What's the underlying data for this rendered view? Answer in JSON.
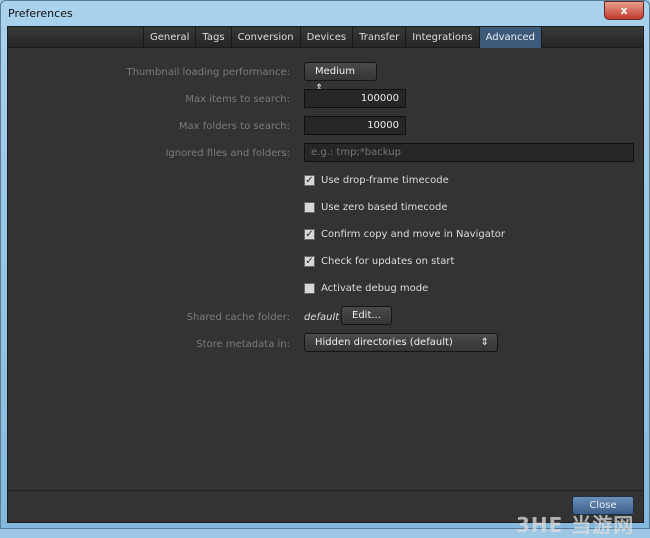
{
  "window": {
    "title": "Preferences",
    "close_glyph": "x"
  },
  "tabs": [
    {
      "label": "General"
    },
    {
      "label": "Tags"
    },
    {
      "label": "Conversion"
    },
    {
      "label": "Devices"
    },
    {
      "label": "Transfer"
    },
    {
      "label": "Integrations"
    },
    {
      "label": "Advanced",
      "active": true
    }
  ],
  "form": {
    "thumb_label": "Thumbnail loading performance:",
    "thumb_value": "Medium",
    "max_items_label": "Max items to search:",
    "max_items_value": "100000",
    "max_folders_label": "Max folders to search:",
    "max_folders_value": "10000",
    "ignored_label": "Ignored files and folders:",
    "ignored_value": "",
    "ignored_placeholder": "e.g.: tmp;*backup",
    "checkboxes": [
      {
        "label": "Use drop-frame timecode",
        "checked": true
      },
      {
        "label": "Use zero based timecode",
        "checked": false
      },
      {
        "label": "Confirm copy and move in Navigator",
        "checked": true
      },
      {
        "label": "Check for updates on start",
        "checked": true
      },
      {
        "label": "Activate debug mode",
        "checked": false
      }
    ],
    "cache_label": "Shared cache folder:",
    "cache_value": "default",
    "edit_label": "Edit...",
    "metadata_label": "Store metadata in:",
    "metadata_value": "Hidden directories (default)"
  },
  "footer": {
    "close_label": "Close"
  },
  "watermark": "3HE 当游网",
  "colors": {
    "accent": "#3d5a78",
    "background": "#333333"
  }
}
